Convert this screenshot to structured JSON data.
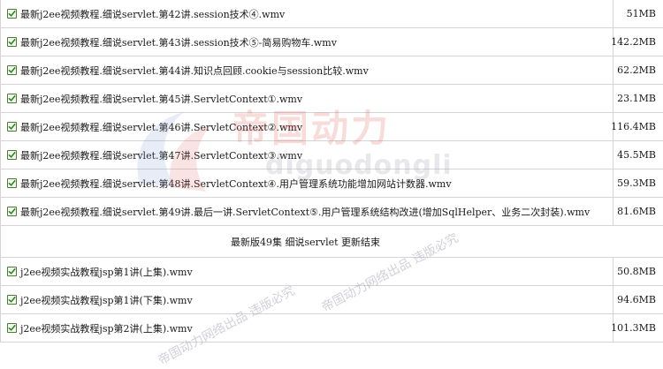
{
  "files_part1": [
    {
      "name": "最新j2ee视频教程.细说servlet.第42讲.session技术④.wmv",
      "size": "51MB",
      "checked": true
    },
    {
      "name": "最新j2ee视频教程.细说servlet.第43讲.session技术⑤-简易购物车.wmv",
      "size": "142.2MB",
      "checked": true
    },
    {
      "name": "最新j2ee视频教程.细说servlet.第44讲.知识点回顾.cookie与session比较.wmv",
      "size": "62.2MB",
      "checked": true
    },
    {
      "name": "最新j2ee视频教程.细说servlet.第45讲.ServletContext①.wmv",
      "size": "23.1MB",
      "checked": true
    },
    {
      "name": "最新j2ee视频教程.细说servlet.第46讲.ServletContext②.wmv",
      "size": "116.4MB",
      "checked": true
    },
    {
      "name": "最新j2ee视频教程.细说servlet.第47讲.ServletContext③.wmv",
      "size": "45.5MB",
      "checked": true
    },
    {
      "name": "最新j2ee视频教程.细说servlet.第48讲.ServletContext④.用户管理系统功能增加网站计数器.wmv",
      "size": "59.3MB",
      "checked": true
    },
    {
      "name": "最新j2ee视频教程.细说servlet.第49讲.最后一讲.ServletContext⑤.用户管理系统结构改进(增加SqlHelper、业务二次封装).wmv",
      "size": "81.6MB",
      "checked": true
    }
  ],
  "section_title": "最新版49集 细说servlet 更新结束",
  "files_part2": [
    {
      "name": "j2ee视频实战教程jsp第1讲(上集).wmv",
      "size": "50.8MB",
      "checked": true
    },
    {
      "name": "j2ee视频实战教程jsp第1讲(下集).wmv",
      "size": "94.6MB",
      "checked": true
    },
    {
      "name": "j2ee视频实战教程jsp第2讲(上集).wmv",
      "size": "101.3MB",
      "checked": true
    }
  ],
  "watermark": {
    "cn": "帝国动力",
    "en": "diguodongli",
    "diagonal": "帝国动力网络出品  违版必究",
    "diagonal2": "帝国动力网络出品  违版必究"
  },
  "colors": {
    "border": "#d4d4d4",
    "checkbox": "#4c7a34",
    "checkmark": "#2e8b1e"
  },
  "icons": {
    "checkbox": "checkbox-checked-icon"
  }
}
